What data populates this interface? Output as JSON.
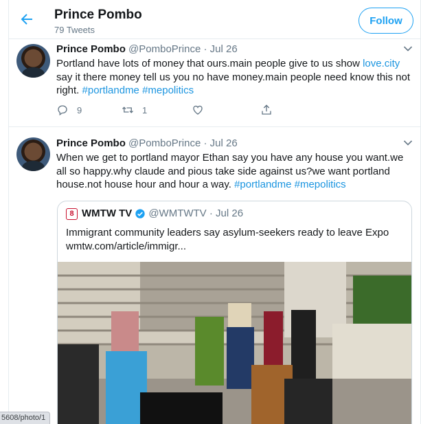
{
  "header": {
    "name": "Prince Pombo",
    "tweet_count": "79 Tweets",
    "follow_label": "Follow"
  },
  "tweets": [
    {
      "name": "Prince Pombo",
      "handle": "@PomboPrince · Jul 26",
      "text_pre": "Portland have lots of money that ours.main people give to us show ",
      "link": "love.city",
      "text_post": " say it there money tell us you no have money.main people need know this not right.  ",
      "hashtags": "#portlandme #mepolitics",
      "replies": "9",
      "retweets": "1"
    },
    {
      "name": "Prince Pombo",
      "handle": "@PomboPrince · Jul 26",
      "text": "When we get to portland mayor Ethan say you have any house you want.we all so happy.why claude and pious take side against us?we want portland house.not house hour and hour a way. ",
      "hashtags": "#portlandme #mepolitics",
      "quote": {
        "logo": "8",
        "name": "WMTW TV",
        "handle": "@WMTWTV · Jul 26",
        "text": "Immigrant community leaders say asylum-seekers ready to leave Expo wmtw.com/article/immigr..."
      }
    }
  ],
  "status_url": "5608/photo/1",
  "colors": {
    "accent": "#1da1f2",
    "link": "#1b95e0",
    "muted": "#657786",
    "border": "#e6ecf0"
  },
  "icons": [
    "back-arrow-icon",
    "chevron-down-icon",
    "reply-icon",
    "retweet-icon",
    "like-icon",
    "share-icon",
    "verified-badge-icon"
  ]
}
